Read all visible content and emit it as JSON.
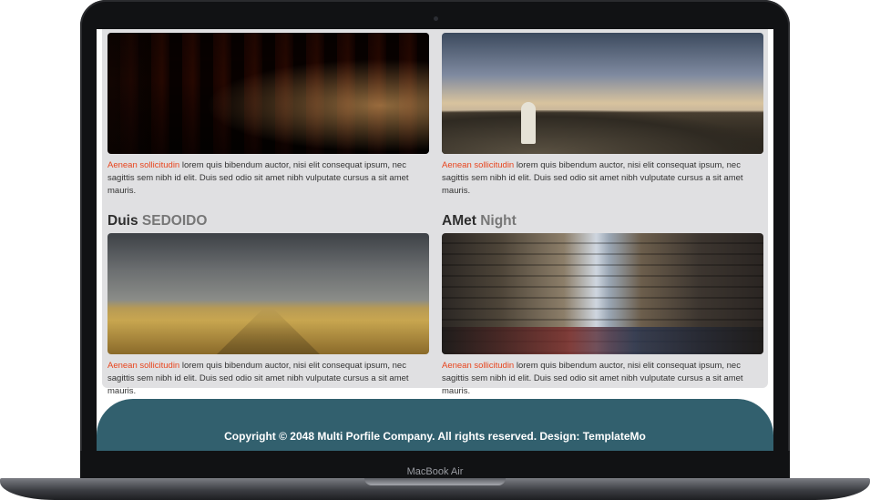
{
  "device": {
    "label": "MacBook Air"
  },
  "cards": [
    {
      "image": "arches-corridor-photo",
      "desc_accent": "Aenean sollicitudin",
      "desc_rest": " lorem quis bibendum auctor, nisi elit consequat ipsum, nec sagittis sem nibh id elit. Duis sed odio sit amet nibh vulputate cursus a sit amet mauris."
    },
    {
      "image": "cliff-monk-photo",
      "desc_accent": "Aenean sollicitudin",
      "desc_rest": " lorem quis bibendum auctor, nisi elit consequat ipsum, nec sagittis sem nibh id elit. Duis sed odio sit amet nibh vulputate cursus a sit amet mauris."
    },
    {
      "title_main": "Duis",
      "title_muted": "SEDOIDO",
      "image": "field-path-photo",
      "desc_accent": "Aenean sollicitudin",
      "desc_rest": " lorem quis bibendum auctor, nisi elit consequat ipsum, nec sagittis sem nibh id elit. Duis sed odio sit amet nibh vulputate cursus a sit amet mauris."
    },
    {
      "title_main": "AMet",
      "title_muted": "Night",
      "image": "city-street-photo",
      "desc_accent": "Aenean sollicitudin",
      "desc_rest": " lorem quis bibendum auctor, nisi elit consequat ipsum, nec sagittis sem nibh id elit. Duis sed odio sit amet nibh vulputate cursus a sit amet mauris."
    }
  ],
  "footer": {
    "copyright": "Copyright © 2048 Multi Porfile Company. All rights reserved. Design: TemplateMo"
  },
  "colors": {
    "accent": "#e8451e",
    "footer_bg": "#32606e",
    "panel_bg": "#e0e0e2"
  }
}
